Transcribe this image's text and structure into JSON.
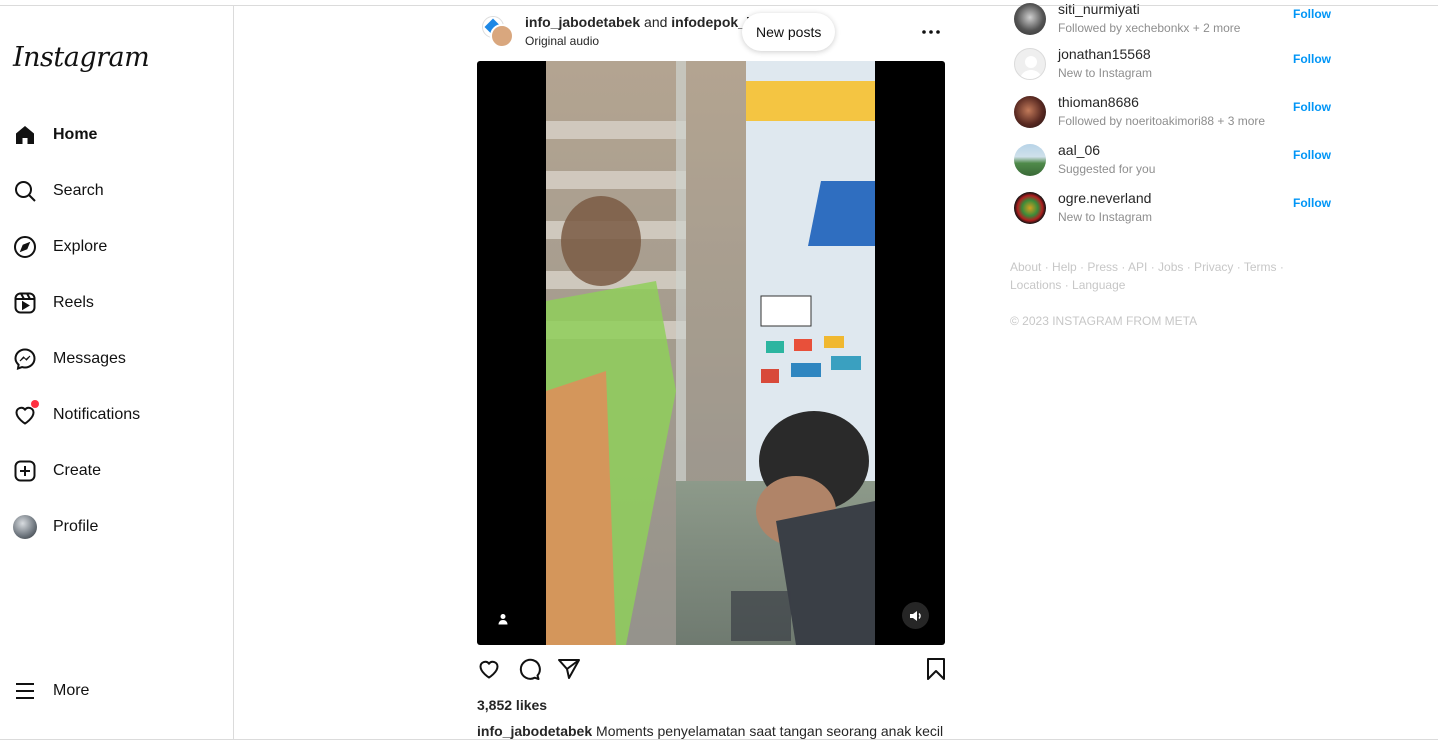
{
  "app": {
    "logo": "Instagram"
  },
  "sidebar": {
    "items": [
      {
        "label": "Home",
        "icon": "home-icon"
      },
      {
        "label": "Search",
        "icon": "search-icon"
      },
      {
        "label": "Explore",
        "icon": "compass-icon"
      },
      {
        "label": "Reels",
        "icon": "reels-icon"
      },
      {
        "label": "Messages",
        "icon": "messenger-icon"
      },
      {
        "label": "Notifications",
        "icon": "heart-icon"
      },
      {
        "label": "Create",
        "icon": "plus-square-icon"
      },
      {
        "label": "Profile",
        "icon": "avatar"
      }
    ],
    "more": {
      "label": "More",
      "icon": "menu-icon"
    }
  },
  "post": {
    "user1": "info_jabodetabek",
    "and": "and",
    "user2": "infodepok_id",
    "audio": "Original audio",
    "new_posts": "New posts",
    "likes": "3,852 likes",
    "caption_user": "info_jabodetabek",
    "caption_text": "Moments penyelamatan saat tangan seorang anak kecil"
  },
  "suggestions": [
    {
      "name": "siti_nurmiyati",
      "sub": "Followed by xechebonkx + 2 more",
      "follow": "Follow"
    },
    {
      "name": "jonathan15568",
      "sub": "New to Instagram",
      "follow": "Follow"
    },
    {
      "name": "thioman8686",
      "sub": "Followed by noeritoakimori88 + 3 more",
      "follow": "Follow"
    },
    {
      "name": "aal_06",
      "sub": "Suggested for you",
      "follow": "Follow"
    },
    {
      "name": "ogre.neverland",
      "sub": "New to Instagram",
      "follow": "Follow"
    }
  ],
  "footer": {
    "links": "About · Help · Press · API · Jobs · Privacy · Terms · Locations · Language",
    "copyright": "© 2023 INSTAGRAM FROM META"
  },
  "colors": {
    "accent": "#0095f6",
    "notification": "#ff3040",
    "muted": "#8e8e8e"
  }
}
